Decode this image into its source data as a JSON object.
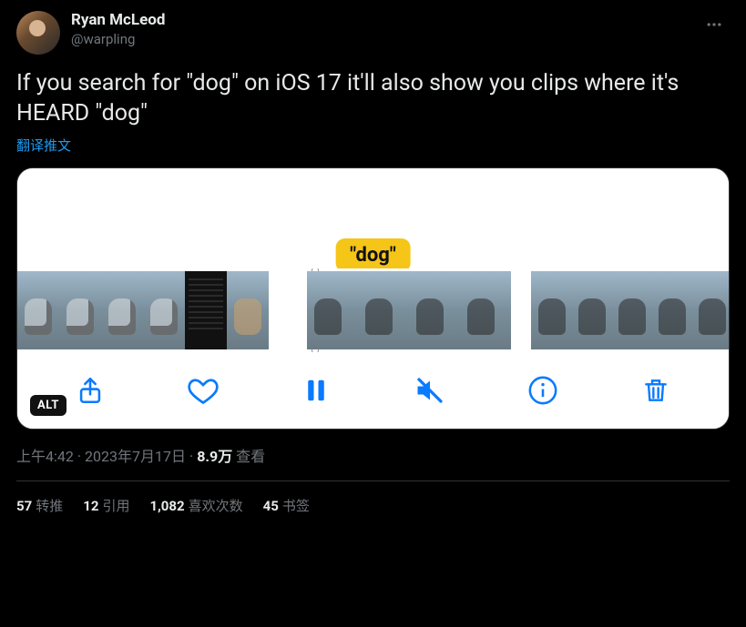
{
  "author": {
    "display_name": "Ryan McLeod",
    "handle": "@warpling"
  },
  "tweet_text": "If you search for \"dog\" on iOS 17 it'll also show you clips where it's HEARD \"dog\"",
  "translate_label": "翻译推文",
  "media": {
    "caption_bubble": "\"dog\"",
    "alt_badge": "ALT",
    "toolbar_icons": {
      "share": "share-icon",
      "favorite": "heart-icon",
      "pause": "pause-icon",
      "mute": "mute-icon",
      "info": "info-icon",
      "trash": "trash-icon"
    }
  },
  "meta": {
    "time": "上午4:42",
    "date": "2023年7月17日",
    "views_number": "8.9万",
    "views_label": "查看"
  },
  "stats": {
    "retweets_num": "57",
    "retweets_label": "转推",
    "quotes_num": "12",
    "quotes_label": "引用",
    "likes_num": "1,082",
    "likes_label": "喜欢次数",
    "bookmarks_num": "45",
    "bookmarks_label": "书签"
  }
}
